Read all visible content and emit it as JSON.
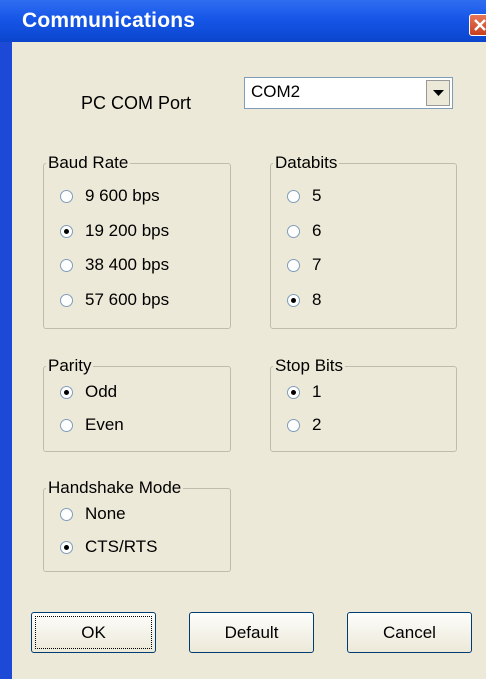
{
  "window": {
    "title": "Communications"
  },
  "com_port": {
    "label": "PC COM Port",
    "value": "COM2"
  },
  "baud_rate": {
    "title": "Baud Rate",
    "options": [
      {
        "label": "9 600 bps",
        "checked": false
      },
      {
        "label": "19 200 bps",
        "checked": true
      },
      {
        "label": "38 400 bps",
        "checked": false
      },
      {
        "label": "57 600 bps",
        "checked": false
      }
    ]
  },
  "databits": {
    "title": "Databits",
    "options": [
      {
        "label": "5",
        "checked": false
      },
      {
        "label": "6",
        "checked": false
      },
      {
        "label": "7",
        "checked": false
      },
      {
        "label": "8",
        "checked": true
      }
    ]
  },
  "parity": {
    "title": "Parity",
    "options": [
      {
        "label": "Odd",
        "checked": true
      },
      {
        "label": "Even",
        "checked": false
      }
    ]
  },
  "stop_bits": {
    "title": "Stop Bits",
    "options": [
      {
        "label": "1",
        "checked": true
      },
      {
        "label": "2",
        "checked": false
      }
    ]
  },
  "handshake": {
    "title": "Handshake Mode",
    "options": [
      {
        "label": "None",
        "checked": false
      },
      {
        "label": "CTS/RTS",
        "checked": true
      }
    ]
  },
  "buttons": {
    "ok": "OK",
    "default": "Default",
    "cancel": "Cancel"
  },
  "colors": {
    "titlebar": "#1656e8",
    "dialog_face": "#ece9d8",
    "close_button": "#d4502c"
  }
}
